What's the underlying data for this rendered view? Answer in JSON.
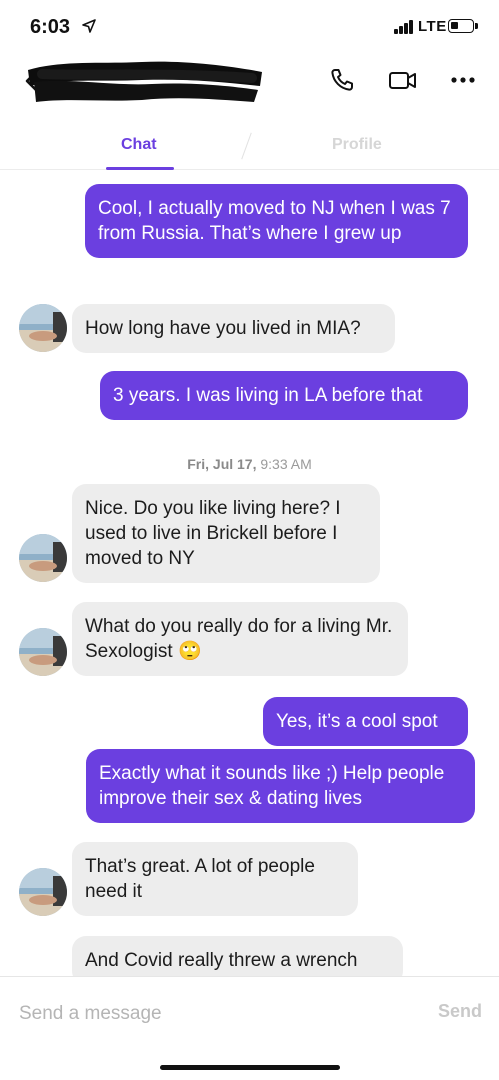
{
  "status_bar": {
    "time": "6:03",
    "network": "LTE",
    "battery_level": 0.35
  },
  "header": {
    "back_icon": "chevron-left-icon",
    "phone_icon": "phone-icon",
    "video_icon": "video-camera-icon",
    "more_icon": "more-horizontal-icon"
  },
  "tabs": [
    {
      "label": "Chat",
      "active": true
    },
    {
      "label": "Profile",
      "active": false
    }
  ],
  "messages": [
    {
      "from": "me",
      "text": "Cool, I actually moved to NJ when I was 7 from Russia. That’s where I grew up"
    },
    {
      "from": "them",
      "text": "How long have you lived in MIA?"
    },
    {
      "from": "me",
      "text": "3 years. I was living in LA before that"
    },
    {
      "from": "them",
      "text": "Nice. Do you like living here? I used to live in Brickell before I moved to NY"
    },
    {
      "from": "them",
      "text": "What do you really do for a living Mr. Sexologist 🙄"
    },
    {
      "from": "me",
      "text": "Yes, it’s a cool spot"
    },
    {
      "from": "me",
      "text": "Exactly what it sounds like ;) Help people improve their sex & dating lives"
    },
    {
      "from": "them",
      "text": "That’s great. A lot of people need it"
    },
    {
      "from": "them",
      "text": "And Covid really threw a wrench"
    }
  ],
  "timestamp": {
    "day": "Fri, Jul 17,",
    "time": "9:33 AM"
  },
  "composer": {
    "placeholder": "Send a message",
    "send_label": "Send"
  },
  "colors": {
    "accent": "#6b3fe0",
    "received_bubble": "#ededed",
    "inactive_tab": "#d6d6d6"
  }
}
